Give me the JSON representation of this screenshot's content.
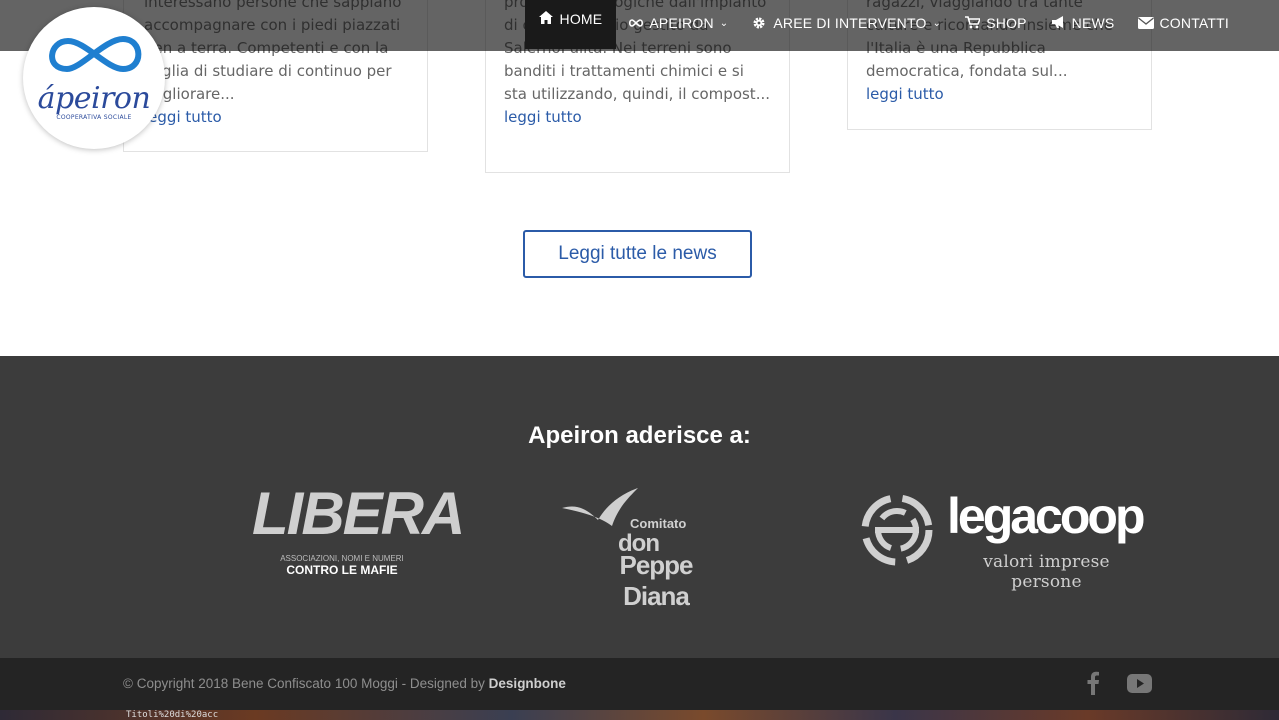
{
  "header": {
    "logo": {
      "wordmark": "ápeiron",
      "subtitle": "COOPERATIVA SOCIALE"
    },
    "nav": [
      {
        "label": "HOME",
        "icon": "home-icon",
        "active": true
      },
      {
        "label": "APEIRON",
        "icon": "infinity-icon",
        "dropdown": true
      },
      {
        "label": "AREE DI INTERVENTO",
        "icon": "gear-icon",
        "dropdown": true
      },
      {
        "label": "SHOP",
        "icon": "cart-icon"
      },
      {
        "label": "NEWS",
        "icon": "megaphone-icon"
      },
      {
        "label": "CONTATTI",
        "icon": "envelope-icon"
      }
    ]
  },
  "news": [
    {
      "excerpt": "interessano persone che sappiano accompagnare con i piedi piazzati ben a terra. Competenti e con la voglia di studiare di continuo per migliorare...",
      "more": "leggi tutto"
    },
    {
      "excerpt": "produzioni biologiche dall'impianto di compostaggio gestito da SalernoPulita. Nei terreni sono banditi i trattamenti chimici e si sta utilizzando, quindi, il compost...",
      "more": "leggi tutto"
    },
    {
      "excerpt": "ragazzi, viaggiando tra tante culture e ricordando insieme che l'Italia è una Repubblica democratica, fondata sul...",
      "more": "leggi tutto"
    }
  ],
  "all_news_button": "Leggi tutte le news",
  "footer": {
    "title": "Apeiron aderisce a:",
    "partners": {
      "libera": {
        "name": "LIBERA",
        "line1": "ASSOCIAZIONI, NOMI E NUMERI",
        "line2": "CONTRO LE MAFIE"
      },
      "diana": {
        "line1": "Comitato",
        "line2": "don",
        "line3": "Peppe Diana"
      },
      "legacoop": {
        "name": "legacoop",
        "tagline": "valori imprese persone"
      }
    },
    "copyright_prefix": "© Copyright 2018 Bene Confiscato 100 Moggi - Designed by ",
    "copyright_brand": "Designbone",
    "social": [
      "facebook-icon",
      "youtube-icon"
    ]
  },
  "strip_text": "Titoli%20di%20acc"
}
